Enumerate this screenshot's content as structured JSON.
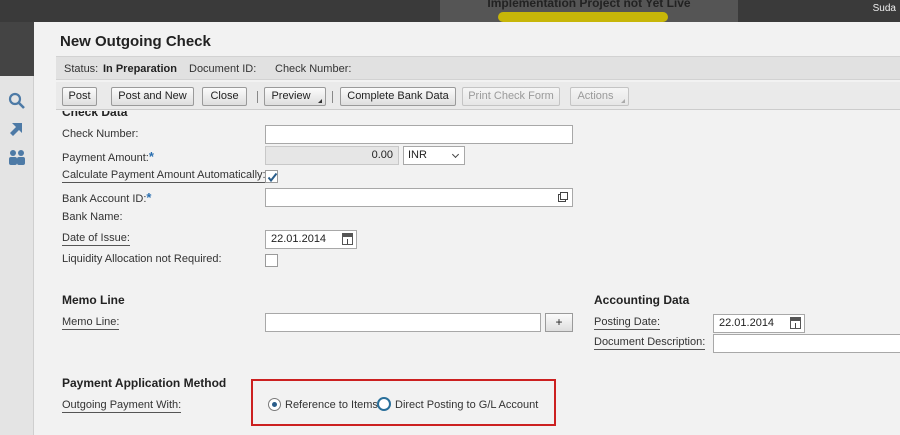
{
  "banner": {
    "text": "Implementation Project not Yet Live"
  },
  "user": {
    "name": "Suda"
  },
  "dialog": {
    "title": "New Outgoing Check",
    "status": {
      "status_label": "Status:",
      "status_value": "In Preparation",
      "document_id_label": "Document ID:",
      "check_number_label": "Check Number:"
    },
    "toolbar": {
      "post": "Post",
      "post_and_new": "Post and New",
      "close": "Close",
      "preview": "Preview",
      "complete_bank_data": "Complete Bank Data",
      "print_check_form": "Print Check Form",
      "actions": "Actions"
    }
  },
  "check_data": {
    "heading": "Check Data",
    "check_number_label": "Check Number:",
    "check_number_value": "",
    "payment_amount_label": "Payment Amount:",
    "payment_amount_value": "0.00",
    "currency": "INR",
    "calc_auto_label": "Calculate Payment Amount Automatically:",
    "calc_auto_checked": true,
    "bank_account_label": "Bank Account ID:",
    "bank_account_value": "",
    "bank_name_label": "Bank Name:",
    "date_of_issue_label": "Date of Issue:",
    "date_of_issue_value": "22.01.2014",
    "liquidity_label": "Liquidity Allocation not Required:",
    "liquidity_checked": false
  },
  "memo": {
    "heading": "Memo Line",
    "memo_line_label": "Memo Line:",
    "memo_line_value": "",
    "add_button": "+"
  },
  "accounting": {
    "heading": "Accounting Data",
    "posting_date_label": "Posting Date:",
    "posting_date_value": "22.01.2014",
    "document_description_label": "Document Description:",
    "document_description_value": ""
  },
  "payment_application": {
    "heading": "Payment Application Method",
    "outgoing_label": "Outgoing Payment With:",
    "options": [
      "Reference to Items",
      "Direct Posting to G/L Account"
    ],
    "selected": "Reference to Items"
  },
  "colors": {
    "required": "#2a6fb0",
    "highlight_box": "#cc2020",
    "banner_scribble": "#d4c100"
  },
  "icons": [
    "search-icon",
    "pointer-icon",
    "people-icon",
    "calendar-icon",
    "value-help-icon",
    "dropdown-icon",
    "checkmark-icon"
  ]
}
